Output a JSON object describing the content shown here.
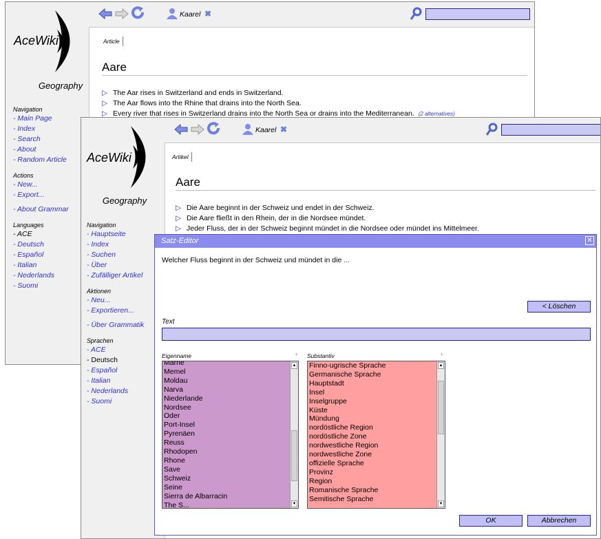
{
  "window_back": {
    "user": "Kaarel",
    "logo": "AceWiki",
    "wiki_name": "Geography",
    "tab": "Article",
    "title": "Aare",
    "sentences": [
      "The Aar rises in Switzerland and ends in Switzerland.",
      "The Aar flows into the Rhine that drains into the North Sea.",
      "Every river that rises in Switzerland drains into the North Sea or drains into the Mediterranean."
    ],
    "alternatives": "(2 alternatives)",
    "nav_head": "Navigation",
    "nav": [
      "Main Page",
      "Index",
      "Search",
      "About",
      "Random Article"
    ],
    "actions_head": "Actions",
    "actions": [
      "New...",
      "Export..."
    ],
    "about_grammar": "About Grammar",
    "lang_head": "Languages",
    "languages": [
      "ACE",
      "Deutsch",
      "Español",
      "Italian",
      "Nederlands",
      "Suomi"
    ]
  },
  "window_front": {
    "user": "Kaarel",
    "logo": "AceWiki",
    "wiki_name": "Geography",
    "tab": "Artikel",
    "title": "Aare",
    "sentences": [
      "Die Aare beginnt in der Schweiz und endet in der Schweiz.",
      "Die Aare fließt in den Rhein, der in die Nordsee mündet.",
      "Jeder Fluss, der in der Schweiz beginnt mündet in die Nordsee oder mündet ins Mittelmeer."
    ],
    "nav_head": "Navigation",
    "nav": [
      "Hauptseite",
      "Index",
      "Suchen",
      "Über",
      "Zufälliger Artikel"
    ],
    "actions_head": "Aktionen",
    "actions": [
      "Neu...",
      "Exportieren..."
    ],
    "about_grammar": "Über Grammatik",
    "lang_head": "Sprachen",
    "languages": [
      "ACE",
      "Deutsch",
      "Español",
      "Italian",
      "Nederlands",
      "Suomi"
    ]
  },
  "editor": {
    "title": "Satz-Editor",
    "sentence": "Welcher Fluss beginnt in der Schweiz und mündet in die",
    "ellipsis": "...",
    "delete_label": "< Löschen",
    "text_label": "Text",
    "text_value": "",
    "col1_label": "Eigenname",
    "col2_label": "Substantiv",
    "plus": "+",
    "proper_names": [
      "Marne",
      "Memel",
      "Moldau",
      "Narva",
      "Niederlande",
      "Nordsee",
      "Oder",
      "Port-Insel",
      "Pyrenäen",
      "Reuss",
      "Rhodopen",
      "Rhone",
      "Save",
      "Schweiz",
      "Seine",
      "Sierra de Albarracin",
      "The S..."
    ],
    "nouns": [
      "Finno-ugrische Sprache",
      "Germanische Sprache",
      "Hauptstadt",
      "Insel",
      "Inselgruppe",
      "Küste",
      "Mündung",
      "nordöstliche Region",
      "nordöstliche Zone",
      "nordwestliche Region",
      "nordwestliche Zone",
      "offizielle Sprache",
      "Provinz",
      "Region",
      "Romanische Sprache",
      "Semitische Sprache"
    ],
    "ok_label": "OK",
    "cancel_label": "Abbrechen"
  },
  "colors": {
    "accent": "#3030d0",
    "header": "#8c8cee",
    "proper_list_bg": "#cc99cc",
    "noun_list_bg": "#ff9f9f"
  }
}
